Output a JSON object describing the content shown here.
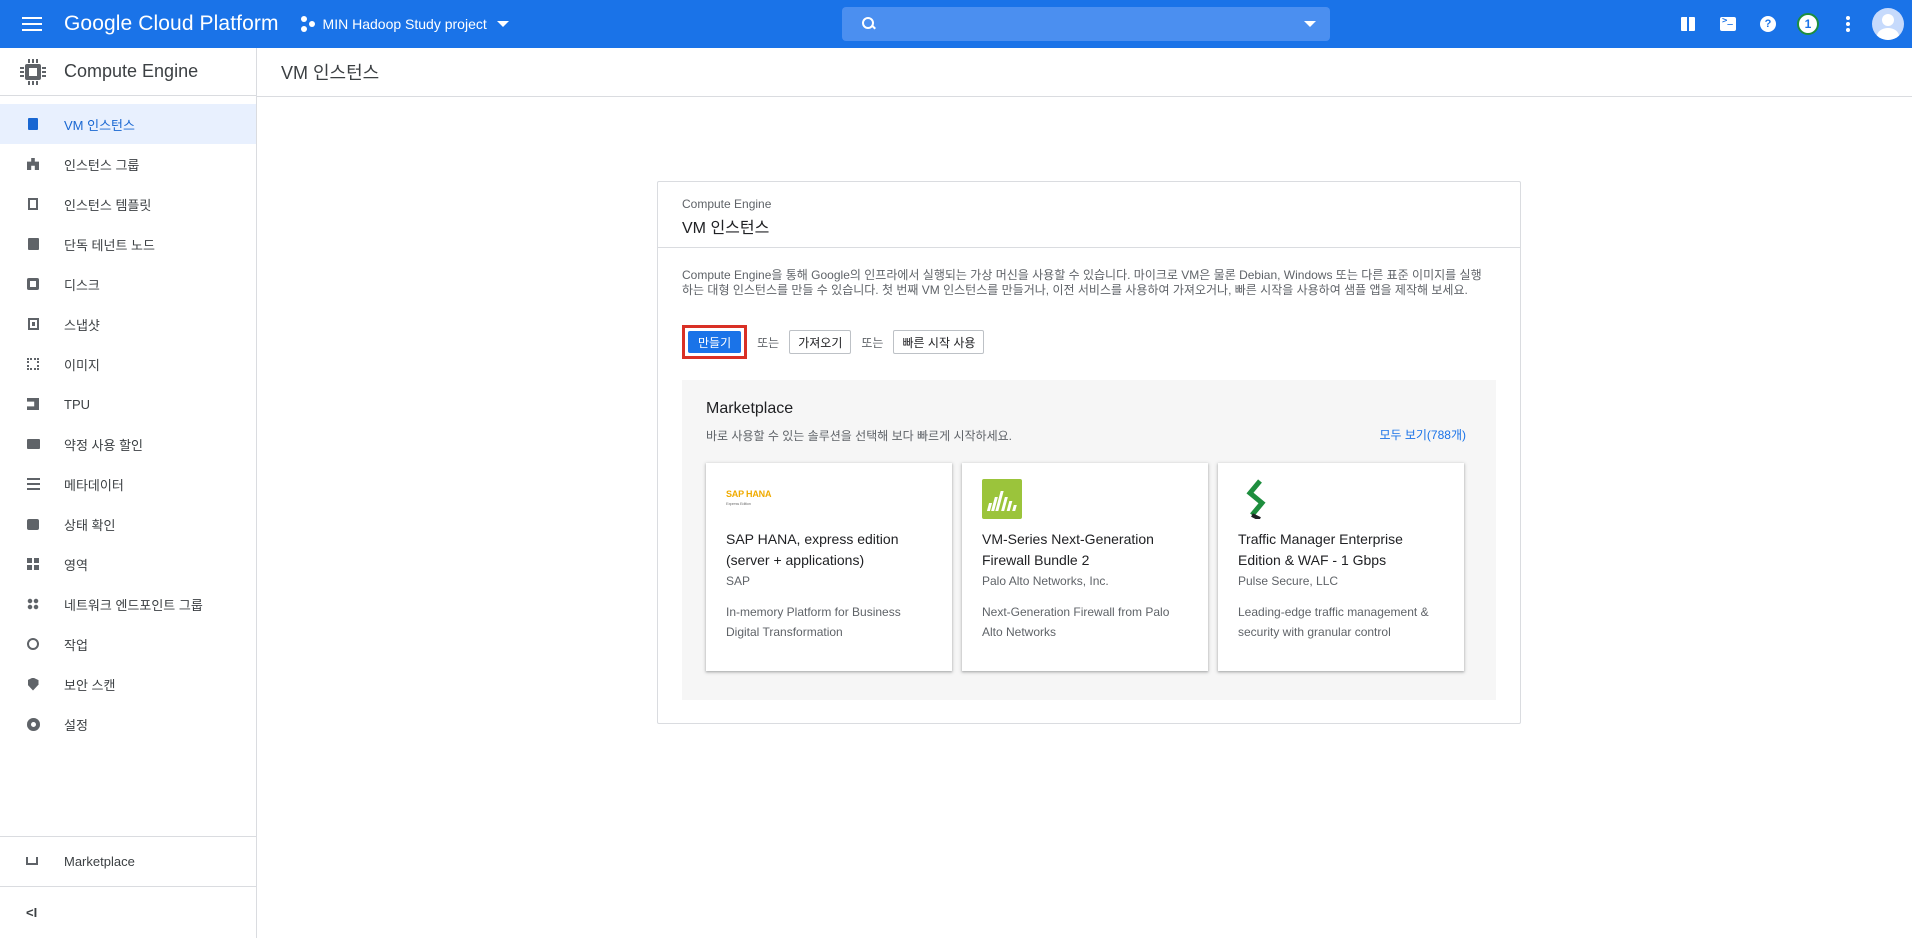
{
  "topbar": {
    "brand": "Google Cloud Platform",
    "project": "MIN Hadoop Study project",
    "search_placeholder": "",
    "notification_count": "1"
  },
  "sidebar": {
    "title": "Compute Engine",
    "items": [
      {
        "label": "VM 인스턴스",
        "icon": "vm-instance-icon",
        "active": true
      },
      {
        "label": "인스턴스 그룹",
        "icon": "instance-group-icon"
      },
      {
        "label": "인스턴스 템플릿",
        "icon": "instance-template-icon"
      },
      {
        "label": "단독 테넌트 노드",
        "icon": "sole-tenant-node-icon"
      },
      {
        "label": "디스크",
        "icon": "disk-icon"
      },
      {
        "label": "스냅샷",
        "icon": "snapshot-icon"
      },
      {
        "label": "이미지",
        "icon": "image-icon"
      },
      {
        "label": "TPU",
        "icon": "tpu-icon"
      },
      {
        "label": "약정 사용 할인",
        "icon": "committed-use-discount-icon"
      },
      {
        "label": "메타데이터",
        "icon": "metadata-icon"
      },
      {
        "label": "상태 확인",
        "icon": "health-check-icon"
      },
      {
        "label": "영역",
        "icon": "zone-icon"
      },
      {
        "label": "네트워크 엔드포인트 그룹",
        "icon": "network-endpoint-group-icon"
      },
      {
        "label": "작업",
        "icon": "operations-icon"
      },
      {
        "label": "보안 스캔",
        "icon": "security-scan-icon"
      },
      {
        "label": "설정",
        "icon": "settings-icon"
      }
    ],
    "marketplace_label": "Marketplace",
    "collapse_label": "<I"
  },
  "page": {
    "title": "VM 인스턴스"
  },
  "card": {
    "subtitle": "Compute Engine",
    "title": "VM 인스턴스",
    "description": "Compute Engine을 통해 Google의 인프라에서 실행되는 가상 머신을 사용할 수 있습니다. 마이크로 VM은 물론 Debian, Windows 또는 다른 표준 이미지를 실행하는 대형 인스턴스를 만들 수 있습니다. 첫 번째 VM 인스턴스를 만들거나, 이전 서비스를 사용하여 가져오거나, 빠른 시작을 사용하여 샘플 앱을 제작해 보세요.",
    "create_label": "만들기",
    "or_label": "또는",
    "import_label": "가져오기",
    "quickstart_label": "빠른 시작 사용"
  },
  "marketplace": {
    "title": "Marketplace",
    "subtitle": "바로 사용할 수 있는 솔루션을 선택해 보다 빠르게 시작하세요.",
    "view_all": "모두 보기(788개)",
    "tiles": [
      {
        "name": "SAP HANA, express edition (server + applications)",
        "vendor": "SAP",
        "description": "In-memory Platform for Business Digital Transformation",
        "logo_text": "SAP HANA",
        "logo_subtext": "Express Edition"
      },
      {
        "name": "VM-Series Next-Generation Firewall Bundle 2",
        "vendor": "Palo Alto Networks, Inc.",
        "description": "Next-Generation Firewall from Palo Alto Networks"
      },
      {
        "name": "Traffic Manager Enterprise Edition & WAF - 1 Gbps",
        "vendor": "Pulse Secure, LLC",
        "description": "Leading-edge traffic management & security with granular control"
      }
    ]
  },
  "colors": {
    "topbar": "#1a73e8",
    "active_nav_bg": "#e8f0fe",
    "active_nav_text": "#1967d2",
    "highlight_border": "#d93025"
  }
}
